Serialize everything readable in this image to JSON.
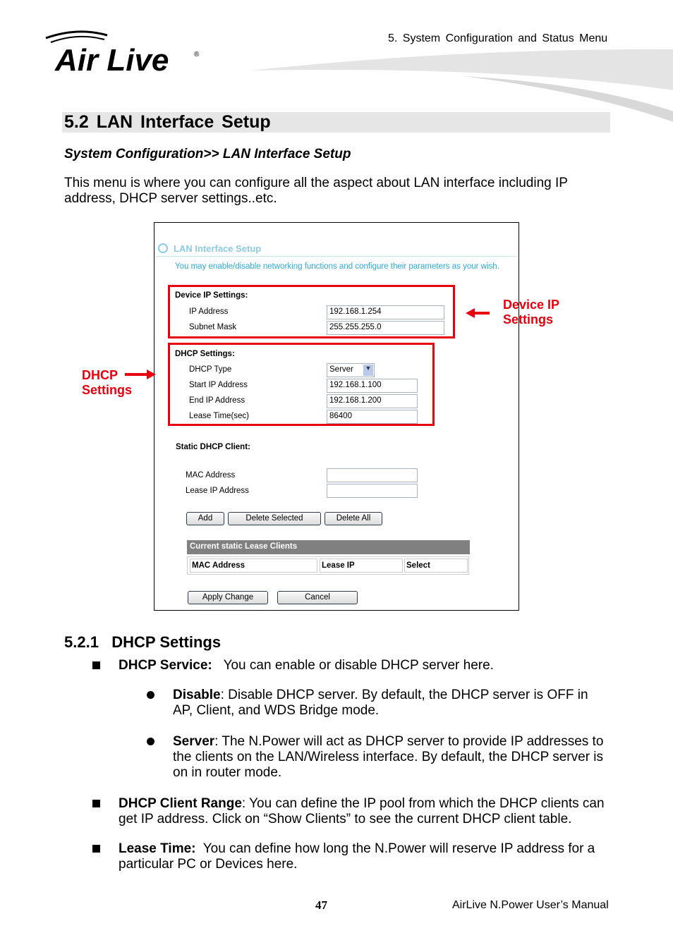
{
  "header": {
    "logo_text": "Air Live",
    "section": "5.  System  Configuration  and  Status  Menu"
  },
  "title": "5.2 LAN  Interface  Setup",
  "subtitle": "System Configuration>> LAN Interface Setup",
  "intro": "This menu is where you can configure all the aspect about LAN interface including IP address, DHCP server settings..etc.",
  "screenshot": {
    "heading": "LAN Interface Setup",
    "description": "You may enable/disable networking functions and configure their parameters as your wish.",
    "device_ip": {
      "label": "Device IP Settings:",
      "ip_label": "IP Address",
      "ip_value": "192.168.1.254",
      "mask_label": "Subnet Mask",
      "mask_value": "255.255.255.0"
    },
    "dhcp": {
      "label": "DHCP Settings:",
      "type_label": "DHCP Type",
      "type_value": "Server",
      "start_label": "Start IP Address",
      "start_value": "192.168.1.100",
      "end_label": "End IP Address",
      "end_value": "192.168.1.200",
      "lease_label": "Lease Time(sec)",
      "lease_value": "86400"
    },
    "static": {
      "label": "Static DHCP Client:",
      "mac_label": "MAC Address",
      "mac_value": "",
      "lease_ip_label": "Lease IP Address",
      "lease_ip_value": ""
    },
    "buttons": {
      "add": "Add",
      "delete_selected": "Delete Selected",
      "delete_all": "Delete All",
      "apply": "Apply Change",
      "cancel": "Cancel"
    },
    "table": {
      "title": "Current static Lease Clients",
      "columns": [
        "MAC Address",
        "Lease IP",
        "Select"
      ]
    }
  },
  "annotations": {
    "device_ip": "Device IP Settings",
    "dhcp": "DHCP Settings"
  },
  "section": {
    "heading": "5.2.1   DHCP Settings",
    "service_term": "DHCP Service:",
    "service_text": "You can enable or disable DHCP server here.",
    "disable_term": "Disable",
    "disable_text": ":   Disable DHCP server.   By default, the DHCP server is OFF in AP, Client, and WDS Bridge mode.",
    "server_term": "Server",
    "server_text": ":   The N.Power will act as DHCP server to provide IP addresses to the clients on the LAN/Wireless interface.   By default, the DHCP server is on in router mode.",
    "range_term": "DHCP Client Range",
    "range_text": ": You can define the IP pool from which the DHCP clients can get IP address.   Click on “Show Clients” to see the current DHCP client table.",
    "lease_term": "Lease Time:",
    "lease_text": "  You can define how long the N.Power will reserve IP address for a particular PC or Devices here."
  },
  "footer": {
    "page": "47",
    "manual": "AirLive N.Power User’s Manual"
  }
}
